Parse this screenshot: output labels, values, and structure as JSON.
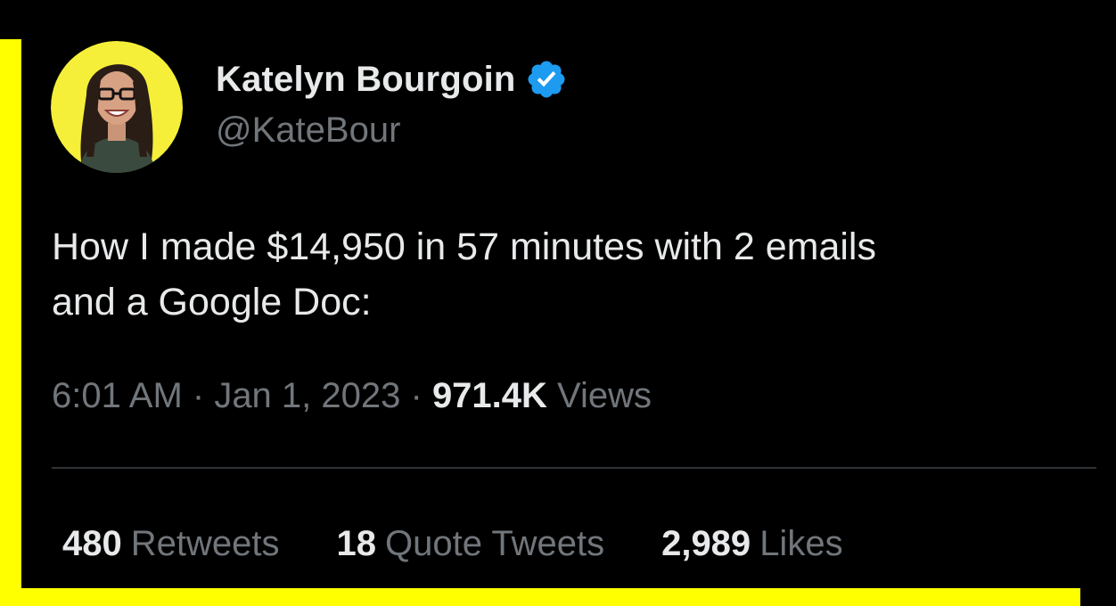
{
  "tweet": {
    "display_name": "Katelyn Bourgoin",
    "handle": "@KateBour",
    "verified_icon": "verified-badge-icon",
    "text_line_1": "How I made $14,950 in 57 minutes with 2 emails",
    "text_line_2": "and a Google Doc:",
    "time": "6:01 AM",
    "separator": "·",
    "date": "Jan 1, 2023",
    "views_count": "971.4K",
    "views_label": "Views",
    "stats": {
      "retweets_count": "480",
      "retweets_label": "Retweets",
      "quotes_count": "18",
      "quotes_label": "Quote Tweets",
      "likes_count": "2,989",
      "likes_label": "Likes"
    }
  },
  "colors": {
    "background": "#000000",
    "frame": "#ffff00",
    "primary_text": "#e7e9ea",
    "secondary_text": "#71767b",
    "verified_blue": "#1d9bf0",
    "avatar_bg": "#f5ef3a",
    "divider": "#2f3336"
  }
}
